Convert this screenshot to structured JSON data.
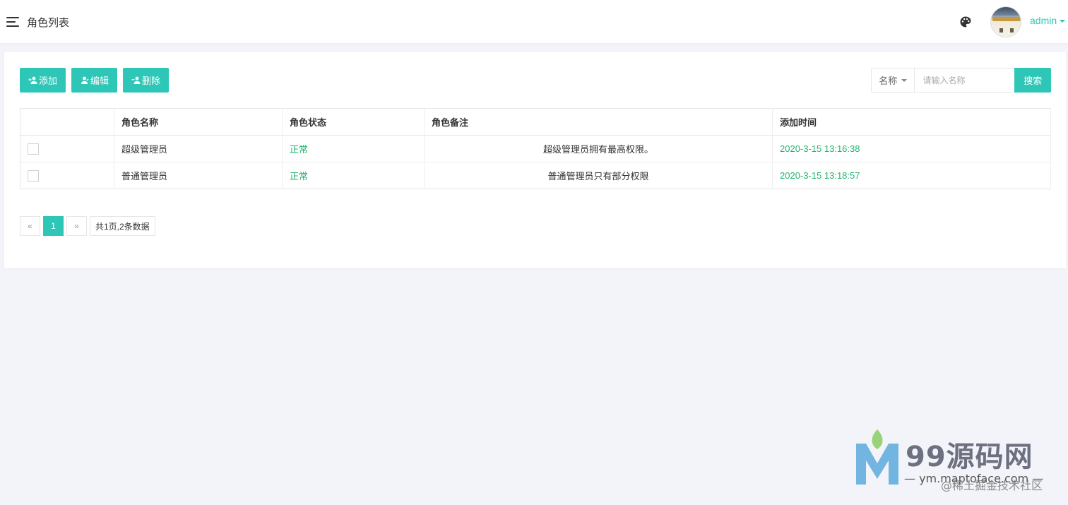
{
  "header": {
    "page_title": "角色列表",
    "user_name": "admin"
  },
  "toolbar": {
    "add_label": "添加",
    "edit_label": "编辑",
    "delete_label": "删除"
  },
  "search": {
    "field_selected": "名称",
    "placeholder": "请输入名称",
    "button_label": "搜索"
  },
  "table": {
    "columns": [
      "",
      "角色名称",
      "角色状态",
      "角色备注",
      "添加时间"
    ],
    "rows": [
      {
        "name": "超级管理员",
        "status": "正常",
        "remark": "超级管理员拥有最高权限。",
        "created": "2020-3-15 13:16:38"
      },
      {
        "name": "普通管理员",
        "status": "正常",
        "remark": "普通管理员只有部分权限",
        "created": "2020-3-15 13:18:57"
      }
    ]
  },
  "pagination": {
    "prev": "«",
    "current": "1",
    "next": "»",
    "summary": "共1页,2条数据"
  },
  "watermark": {
    "title": "99源码网",
    "subtitle": "— ym.maptoface.com —",
    "credit": "@稀土掘金技术社区"
  },
  "colors": {
    "accent": "#2ec7b7",
    "status_green": "#22b56e",
    "page_bg": "#f3f4f9"
  }
}
